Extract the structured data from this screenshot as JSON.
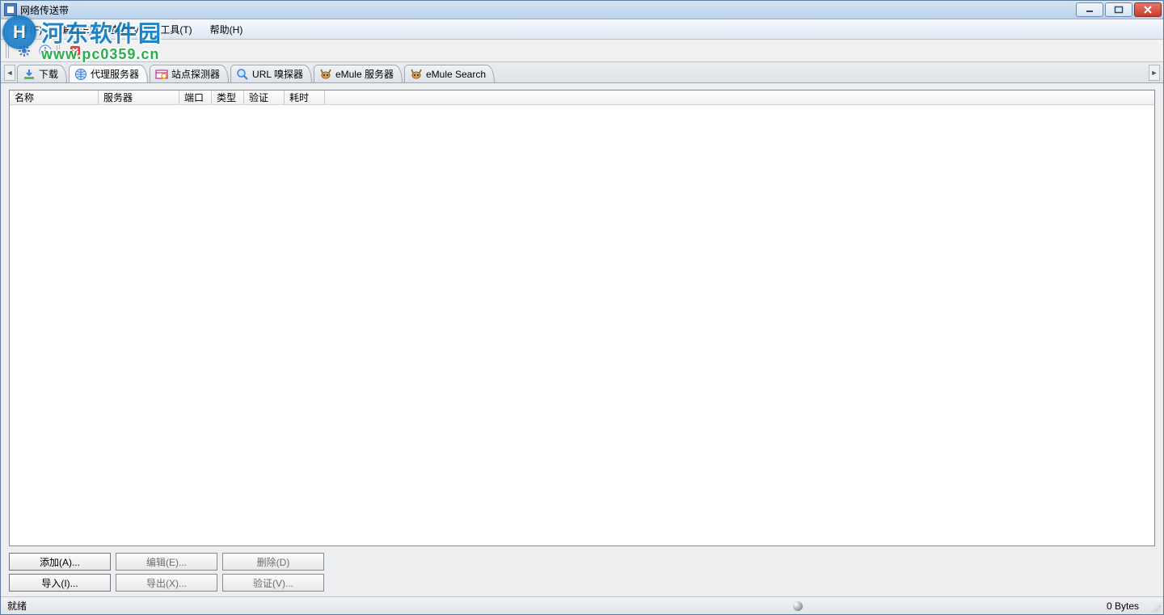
{
  "title": "网络传送带",
  "watermark": {
    "site_cn": "河东软件园",
    "site_url": "www.pc0359.cn"
  },
  "menu": [
    {
      "id": "file",
      "label": "文件(F)"
    },
    {
      "id": "edit",
      "label": "编辑(E)"
    },
    {
      "id": "view",
      "label": "查看(V)"
    },
    {
      "id": "tools",
      "label": "工具(T)"
    },
    {
      "id": "help",
      "label": "帮助(H)"
    }
  ],
  "tabs": [
    {
      "id": "download",
      "label": "下载",
      "icon": "download-icon",
      "active": false
    },
    {
      "id": "proxy",
      "label": "代理服务器",
      "icon": "globe-icon",
      "active": true
    },
    {
      "id": "site-probe",
      "label": "站点探测器",
      "icon": "site-probe-icon",
      "active": false
    },
    {
      "id": "url-sniffer",
      "label": "URL 嗅探器",
      "icon": "magnifier-icon",
      "active": false
    },
    {
      "id": "emule-srv",
      "label": "eMule 服务器",
      "icon": "emule-icon",
      "active": false
    },
    {
      "id": "emule-search",
      "label": "eMule Search",
      "icon": "emule-icon",
      "active": false
    }
  ],
  "columns": [
    {
      "id": "name",
      "label": "名称"
    },
    {
      "id": "server",
      "label": "服务器"
    },
    {
      "id": "port",
      "label": "端口"
    },
    {
      "id": "type",
      "label": "类型"
    },
    {
      "id": "verify",
      "label": "验证"
    },
    {
      "id": "elapsed",
      "label": "耗时"
    }
  ],
  "rows": [],
  "buttons": {
    "add": {
      "label": "添加(A)...",
      "enabled": true
    },
    "edit": {
      "label": "编辑(E)...",
      "enabled": false
    },
    "delete": {
      "label": "删除(D)",
      "enabled": false
    },
    "import": {
      "label": "导入(I)...",
      "enabled": true
    },
    "export": {
      "label": "导出(X)...",
      "enabled": false
    },
    "verify": {
      "label": "验证(V)...",
      "enabled": false
    }
  },
  "status": {
    "ready": "就绪",
    "bytes": "0 Bytes"
  }
}
